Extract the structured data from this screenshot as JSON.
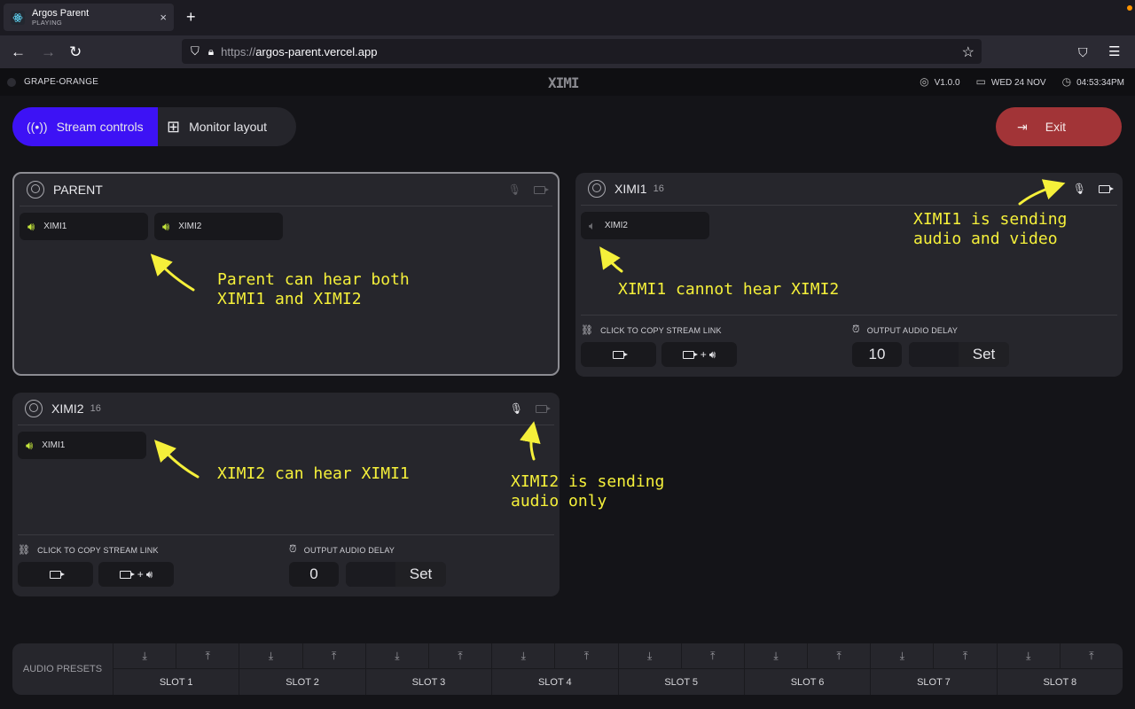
{
  "browser": {
    "tab_title": "Argos Parent",
    "tab_subtitle": "PLAYING",
    "tab_close": "×",
    "new_tab": "+",
    "url_prefix": "https://",
    "url_host": "argos-parent.vercel.app"
  },
  "appbar": {
    "session": "GRAPE-ORANGE",
    "logo": "XIMI",
    "version": "V1.0.0",
    "date": "WED 24 NOV",
    "time": "04:53:34PM"
  },
  "nav": {
    "stream_controls": "Stream controls",
    "monitor_layout": "Monitor layout",
    "exit": "Exit",
    "accent_color": "#3d12f5",
    "exit_color": "#a23437"
  },
  "cards": {
    "parent": {
      "name": "PARENT",
      "mic": "off",
      "cam": "off",
      "hears": [
        {
          "label": "XIMI1",
          "audible": true
        },
        {
          "label": "XIMI2",
          "audible": true
        }
      ]
    },
    "ximi1": {
      "name": "XIMI1",
      "count": "16",
      "mic": "on",
      "cam": "on",
      "hears": [
        {
          "label": "XIMI2",
          "audible": false
        }
      ],
      "copy_label": "CLICK TO COPY STREAM LINK",
      "delay_label": "OUTPUT AUDIO DELAY",
      "delay_value": "10",
      "set_label": "Set"
    },
    "ximi2": {
      "name": "XIMI2",
      "count": "16",
      "mic": "on",
      "cam": "off",
      "hears": [
        {
          "label": "XIMI1",
          "audible": true
        }
      ],
      "copy_label": "CLICK TO COPY STREAM LINK",
      "delay_label": "OUTPUT AUDIO DELAY",
      "delay_value": "0",
      "set_label": "Set"
    }
  },
  "annotations": {
    "parent": "Parent can hear both\nXIMI1 and XIMI2",
    "ximi1_hear": "XIMI1 cannot hear XIMI2",
    "ximi1_send": "XIMI1 is sending\naudio and video",
    "ximi2_hear": "XIMI2 can hear XIMI1",
    "ximi2_send": "XIMI2 is sending\naudio only",
    "color": "#f5f03a"
  },
  "presets": {
    "label": "AUDIO PRESETS",
    "slots": [
      "SLOT 1",
      "SLOT 2",
      "SLOT 3",
      "SLOT 4",
      "SLOT 5",
      "SLOT 6",
      "SLOT 7",
      "SLOT 8"
    ]
  }
}
